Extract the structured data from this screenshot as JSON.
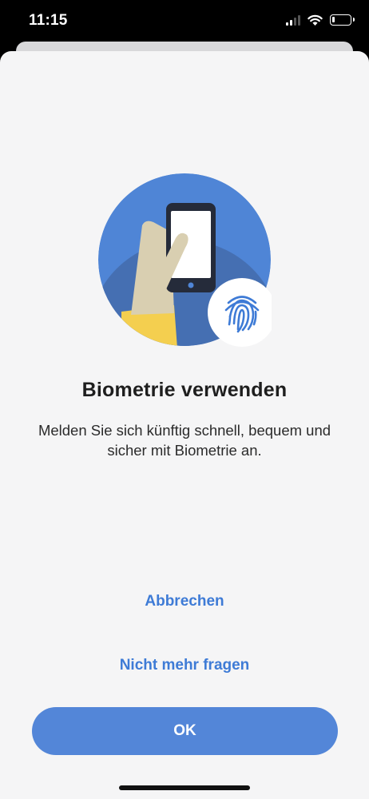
{
  "status_bar": {
    "time": "11:15",
    "signal_bars_active": 2,
    "signal_bars_total": 4,
    "battery_level": 0.15
  },
  "dialog": {
    "illustration": "phone-in-hand-with-fingerprint",
    "title": "Biometrie verwenden",
    "subtitle": "Melden Sie sich künftig schnell, bequem und sicher mit Biometrie an.",
    "cancel_label": "Abbrechen",
    "never_ask_label": "Nicht mehr fragen",
    "ok_label": "OK"
  },
  "colors": {
    "accent": "#3e7bd6",
    "primary_button": "#5386d8",
    "sheet_background": "#f5f5f6",
    "illustration_blue": "#4f85d6",
    "illustration_dark_blue": "#456fb2",
    "sleeve_yellow": "#f4cf4f",
    "hand_skin": "#d9cfb1"
  }
}
